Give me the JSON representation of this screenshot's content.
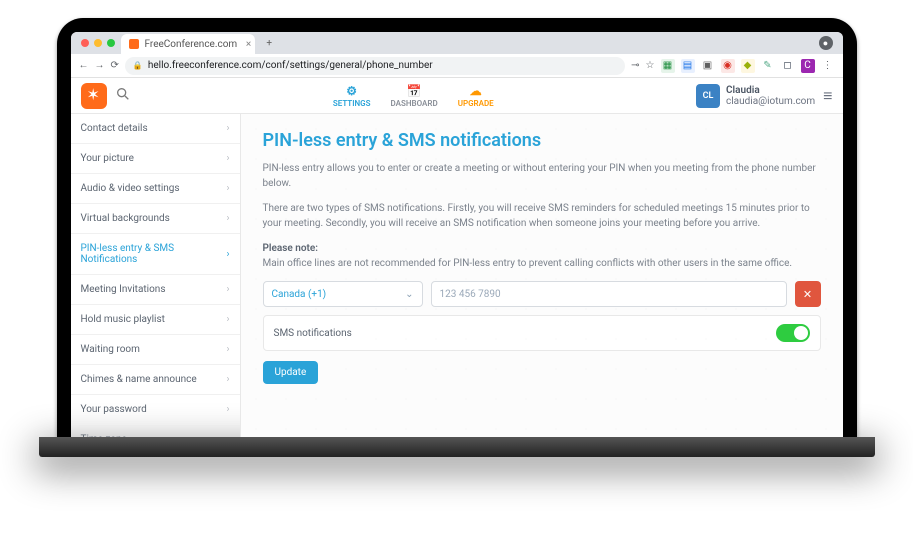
{
  "browser": {
    "tab_title": "FreeConference.com",
    "url": "hello.freeconference.com/conf/settings/general/phone_number"
  },
  "appnav": {
    "settings": "SETTINGS",
    "dashboard": "DASHBOARD",
    "upgrade": "UPGRADE"
  },
  "user": {
    "initials": "CL",
    "name": "Claudia",
    "email": "claudia@iotum.com"
  },
  "sidebar": {
    "items": [
      {
        "label": "Contact details"
      },
      {
        "label": "Your picture"
      },
      {
        "label": "Audio & video settings"
      },
      {
        "label": "Virtual backgrounds"
      },
      {
        "label": "PIN-less entry & SMS Notifications",
        "active": true
      },
      {
        "label": "Meeting Invitations"
      },
      {
        "label": "Hold music playlist"
      },
      {
        "label": "Waiting room"
      },
      {
        "label": "Chimes & name announce"
      },
      {
        "label": "Your password"
      },
      {
        "label": "Time zone"
      }
    ]
  },
  "page": {
    "title": "PIN-less entry & SMS notifications",
    "p1": "PIN-less entry allows you to enter or create a meeting or without entering your PIN when you meeting from the phone number below.",
    "p2": "There are two types of SMS notifications. Firstly, you will receive SMS reminders for scheduled meetings 15 minutes prior to your meeting. Secondly, you will receive an SMS notification when someone joins your meeting before you arrive.",
    "note_label": "Please note:",
    "note_text": "Main office lines are not recommended for PIN-less entry to prevent calling conflicts with other users in the same office.",
    "country": "Canada (+1)",
    "phone_placeholder": "123 456 7890",
    "sms_label": "SMS notifications",
    "update": "Update"
  }
}
